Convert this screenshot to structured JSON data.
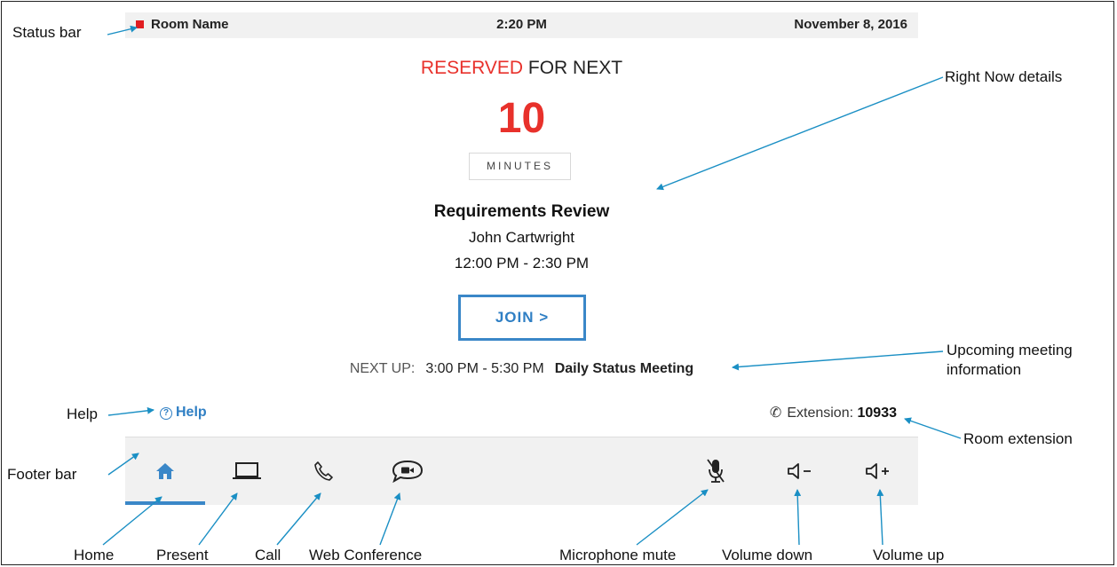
{
  "status_bar": {
    "room_name": "Room Name",
    "time": "2:20 PM",
    "date": "November 8, 2016",
    "status_color": "#e11d21"
  },
  "right_now": {
    "reserved_highlight": "RESERVED",
    "reserved_rest": " FOR NEXT",
    "countdown_value": "10",
    "countdown_unit": "MINUTES",
    "meeting_title": "Requirements Review",
    "organizer": "John Cartwright",
    "time_range": "12:00 PM - 2:30 PM",
    "join_label": "JOIN >"
  },
  "next_up": {
    "label": "NEXT UP:",
    "time_range": "3:00 PM - 5:30 PM",
    "meeting_name": "Daily Status Meeting"
  },
  "help": {
    "icon_glyph": "?",
    "label": "Help"
  },
  "extension": {
    "icon_glyph": "✆",
    "label": "Extension:",
    "number": "10933"
  },
  "footer": {
    "buttons": [
      "home",
      "present",
      "call",
      "web-conference",
      "microphone-mute",
      "volume-down",
      "volume-up"
    ],
    "selected": "home"
  },
  "annotations": {
    "status_bar": "Status bar",
    "right_now_details": "Right Now details",
    "upcoming_line1": "Upcoming meeting",
    "upcoming_line2": "information",
    "help": "Help",
    "room_extension": "Room extension",
    "footer_bar": "Footer bar",
    "home": "Home",
    "present": "Present",
    "call": "Call",
    "web_conference": "Web Conference",
    "microphone_mute": "Microphone mute",
    "volume_down": "Volume down",
    "volume_up": "Volume up"
  },
  "colors": {
    "accent": "#3a87c8",
    "alert": "#e8312b",
    "callout": "#1a8fc4"
  }
}
